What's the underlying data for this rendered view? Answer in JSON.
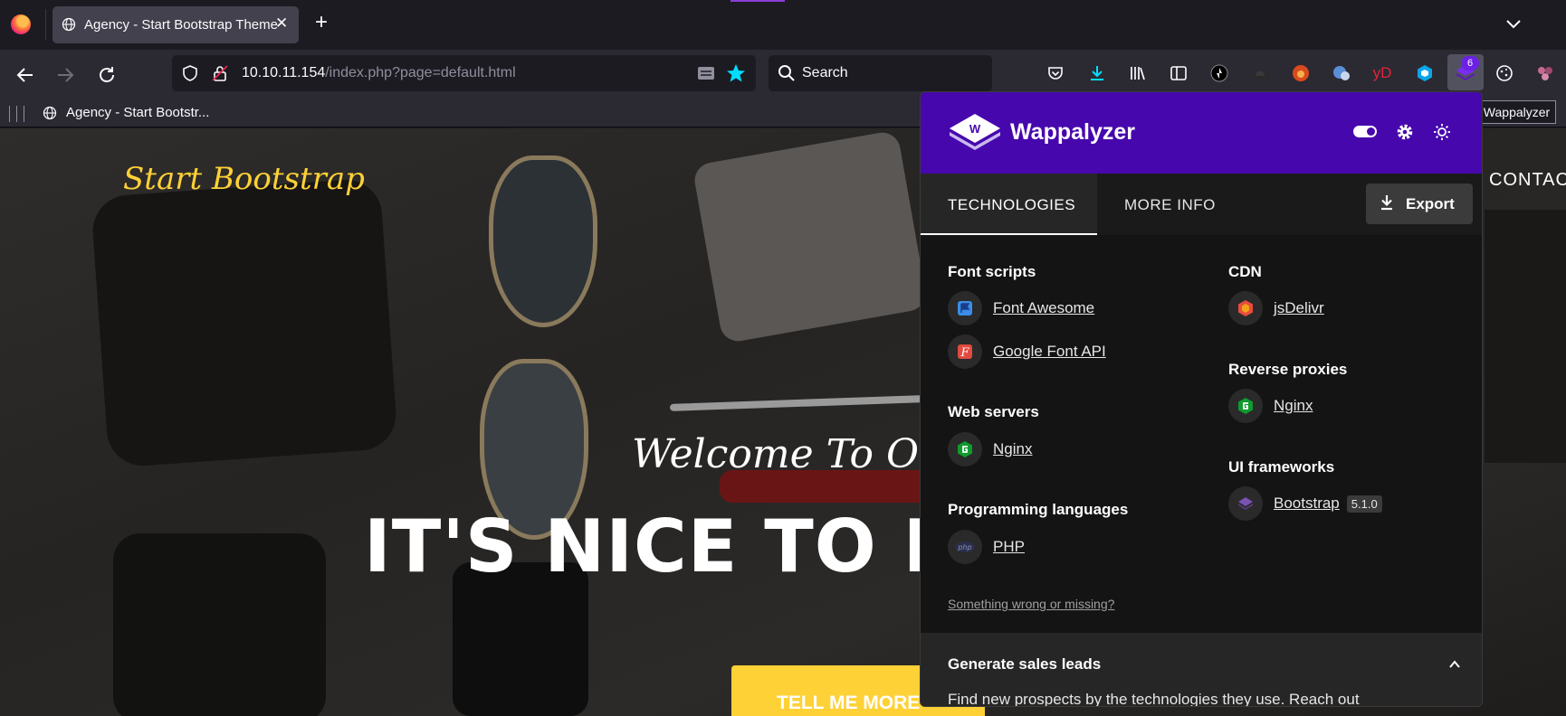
{
  "browser": {
    "tab": {
      "title": "Agency - Start Bootstrap Theme",
      "close": "✕"
    },
    "new_tab": "+",
    "url": {
      "host": "10.10.11.154",
      "path": "/index.php?page=default.html"
    },
    "search": {
      "placeholder": "Search"
    },
    "toolbar_text_icon": "yD",
    "extension_badge": "6",
    "bookmark": "Agency - Start Bootstr...",
    "tooltip": "Wappalyzer"
  },
  "site": {
    "brand": "Start Bootstrap",
    "nav_partial": "CONTAC",
    "welcome": "Welcome To Ou",
    "hero": "IT'S NICE TO M",
    "cta": "TELL ME MORE"
  },
  "wappalyzer": {
    "name": "Wappalyzer",
    "tabs": {
      "technologies": "TECHNOLOGIES",
      "more_info": "MORE INFO"
    },
    "export_label": "Export",
    "categories": {
      "font_scripts": {
        "title": "Font scripts",
        "items": [
          "Font Awesome",
          "Google Font API"
        ]
      },
      "web_servers": {
        "title": "Web servers",
        "items": [
          "Nginx"
        ]
      },
      "programming_languages": {
        "title": "Programming languages",
        "items": [
          "PHP"
        ]
      },
      "cdn": {
        "title": "CDN",
        "items": [
          "jsDelivr"
        ]
      },
      "reverse_proxies": {
        "title": "Reverse proxies",
        "items": [
          "Nginx"
        ]
      },
      "ui_frameworks": {
        "title": "UI frameworks",
        "items": [
          "Bootstrap"
        ],
        "version": "5.1.0"
      }
    },
    "wrong_link": "Something wrong or missing?",
    "leads": {
      "title": "Generate sales leads",
      "text": "Find new prospects by the technologies they use. Reach out"
    },
    "colors": {
      "header": "#4608ad",
      "accent": "#fed136"
    }
  }
}
